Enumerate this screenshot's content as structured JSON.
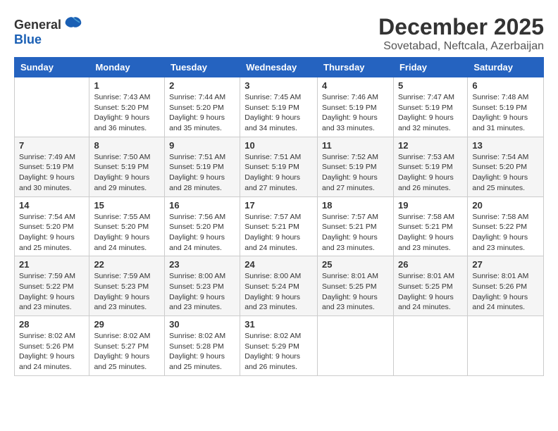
{
  "logo": {
    "general": "General",
    "blue": "Blue"
  },
  "title": {
    "month": "December 2025",
    "location": "Sovetabad, Neftcala, Azerbaijan"
  },
  "days_of_week": [
    "Sunday",
    "Monday",
    "Tuesday",
    "Wednesday",
    "Thursday",
    "Friday",
    "Saturday"
  ],
  "weeks": [
    [
      {
        "day": "",
        "info": ""
      },
      {
        "day": "1",
        "info": "Sunrise: 7:43 AM\nSunset: 5:20 PM\nDaylight: 9 hours\nand 36 minutes."
      },
      {
        "day": "2",
        "info": "Sunrise: 7:44 AM\nSunset: 5:20 PM\nDaylight: 9 hours\nand 35 minutes."
      },
      {
        "day": "3",
        "info": "Sunrise: 7:45 AM\nSunset: 5:19 PM\nDaylight: 9 hours\nand 34 minutes."
      },
      {
        "day": "4",
        "info": "Sunrise: 7:46 AM\nSunset: 5:19 PM\nDaylight: 9 hours\nand 33 minutes."
      },
      {
        "day": "5",
        "info": "Sunrise: 7:47 AM\nSunset: 5:19 PM\nDaylight: 9 hours\nand 32 minutes."
      },
      {
        "day": "6",
        "info": "Sunrise: 7:48 AM\nSunset: 5:19 PM\nDaylight: 9 hours\nand 31 minutes."
      }
    ],
    [
      {
        "day": "7",
        "info": "Sunrise: 7:49 AM\nSunset: 5:19 PM\nDaylight: 9 hours\nand 30 minutes."
      },
      {
        "day": "8",
        "info": "Sunrise: 7:50 AM\nSunset: 5:19 PM\nDaylight: 9 hours\nand 29 minutes."
      },
      {
        "day": "9",
        "info": "Sunrise: 7:51 AM\nSunset: 5:19 PM\nDaylight: 9 hours\nand 28 minutes."
      },
      {
        "day": "10",
        "info": "Sunrise: 7:51 AM\nSunset: 5:19 PM\nDaylight: 9 hours\nand 27 minutes."
      },
      {
        "day": "11",
        "info": "Sunrise: 7:52 AM\nSunset: 5:19 PM\nDaylight: 9 hours\nand 27 minutes."
      },
      {
        "day": "12",
        "info": "Sunrise: 7:53 AM\nSunset: 5:19 PM\nDaylight: 9 hours\nand 26 minutes."
      },
      {
        "day": "13",
        "info": "Sunrise: 7:54 AM\nSunset: 5:20 PM\nDaylight: 9 hours\nand 25 minutes."
      }
    ],
    [
      {
        "day": "14",
        "info": "Sunrise: 7:54 AM\nSunset: 5:20 PM\nDaylight: 9 hours\nand 25 minutes."
      },
      {
        "day": "15",
        "info": "Sunrise: 7:55 AM\nSunset: 5:20 PM\nDaylight: 9 hours\nand 24 minutes."
      },
      {
        "day": "16",
        "info": "Sunrise: 7:56 AM\nSunset: 5:20 PM\nDaylight: 9 hours\nand 24 minutes."
      },
      {
        "day": "17",
        "info": "Sunrise: 7:57 AM\nSunset: 5:21 PM\nDaylight: 9 hours\nand 24 minutes."
      },
      {
        "day": "18",
        "info": "Sunrise: 7:57 AM\nSunset: 5:21 PM\nDaylight: 9 hours\nand 23 minutes."
      },
      {
        "day": "19",
        "info": "Sunrise: 7:58 AM\nSunset: 5:21 PM\nDaylight: 9 hours\nand 23 minutes."
      },
      {
        "day": "20",
        "info": "Sunrise: 7:58 AM\nSunset: 5:22 PM\nDaylight: 9 hours\nand 23 minutes."
      }
    ],
    [
      {
        "day": "21",
        "info": "Sunrise: 7:59 AM\nSunset: 5:22 PM\nDaylight: 9 hours\nand 23 minutes."
      },
      {
        "day": "22",
        "info": "Sunrise: 7:59 AM\nSunset: 5:23 PM\nDaylight: 9 hours\nand 23 minutes."
      },
      {
        "day": "23",
        "info": "Sunrise: 8:00 AM\nSunset: 5:23 PM\nDaylight: 9 hours\nand 23 minutes."
      },
      {
        "day": "24",
        "info": "Sunrise: 8:00 AM\nSunset: 5:24 PM\nDaylight: 9 hours\nand 23 minutes."
      },
      {
        "day": "25",
        "info": "Sunrise: 8:01 AM\nSunset: 5:25 PM\nDaylight: 9 hours\nand 23 minutes."
      },
      {
        "day": "26",
        "info": "Sunrise: 8:01 AM\nSunset: 5:25 PM\nDaylight: 9 hours\nand 24 minutes."
      },
      {
        "day": "27",
        "info": "Sunrise: 8:01 AM\nSunset: 5:26 PM\nDaylight: 9 hours\nand 24 minutes."
      }
    ],
    [
      {
        "day": "28",
        "info": "Sunrise: 8:02 AM\nSunset: 5:26 PM\nDaylight: 9 hours\nand 24 minutes."
      },
      {
        "day": "29",
        "info": "Sunrise: 8:02 AM\nSunset: 5:27 PM\nDaylight: 9 hours\nand 25 minutes."
      },
      {
        "day": "30",
        "info": "Sunrise: 8:02 AM\nSunset: 5:28 PM\nDaylight: 9 hours\nand 25 minutes."
      },
      {
        "day": "31",
        "info": "Sunrise: 8:02 AM\nSunset: 5:29 PM\nDaylight: 9 hours\nand 26 minutes."
      },
      {
        "day": "",
        "info": ""
      },
      {
        "day": "",
        "info": ""
      },
      {
        "day": "",
        "info": ""
      }
    ]
  ]
}
